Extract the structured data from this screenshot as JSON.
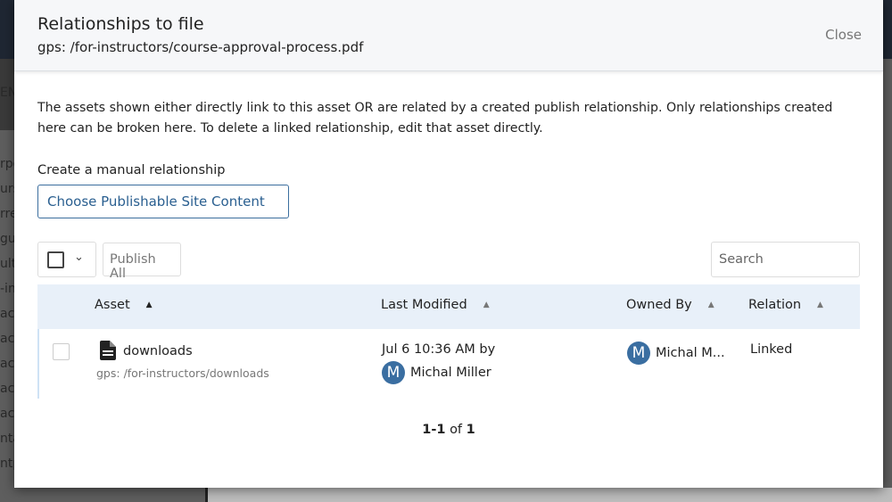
{
  "background": {
    "fragments": [
      "rpo",
      "urs",
      "rre",
      "gu",
      "ult",
      "-in",
      "ac",
      "ac",
      "ac",
      "ac",
      "ac",
      "nta",
      "ntp"
    ],
    "fragment_top": "EN"
  },
  "modal": {
    "title": "Relationships to file",
    "subtitle": "gps: /for-instructors/course-approval-process.pdf",
    "close_label": "Close",
    "description": "The assets shown either directly link to this asset OR are related by a created publish relationship. Only relationships created here can be broken here. To delete a linked relationship, edit that asset directly.",
    "manual_label": "Create a manual relationship",
    "choose_label": "Choose Publishable Site Content",
    "publish_all_label": "Publish All",
    "search_placeholder": "Search",
    "columns": [
      "Asset",
      "Last Modified",
      "Owned By",
      "Relation"
    ],
    "rows": [
      {
        "name": "downloads",
        "path": "gps: /for-instructors/downloads",
        "icon": "document-icon",
        "modified": "Jul 6 10:36 AM by",
        "modified_by": "Michal Miller",
        "modified_by_initial": "M",
        "owner": "Michal M...",
        "owner_initial": "M",
        "relation": "Linked"
      }
    ],
    "pager": {
      "range": "1-1",
      "of": "of",
      "total": "1"
    },
    "colors": {
      "accent": "#3a6ea1",
      "link": "#2a5f90",
      "header_bg": "#e8f0f9"
    }
  }
}
